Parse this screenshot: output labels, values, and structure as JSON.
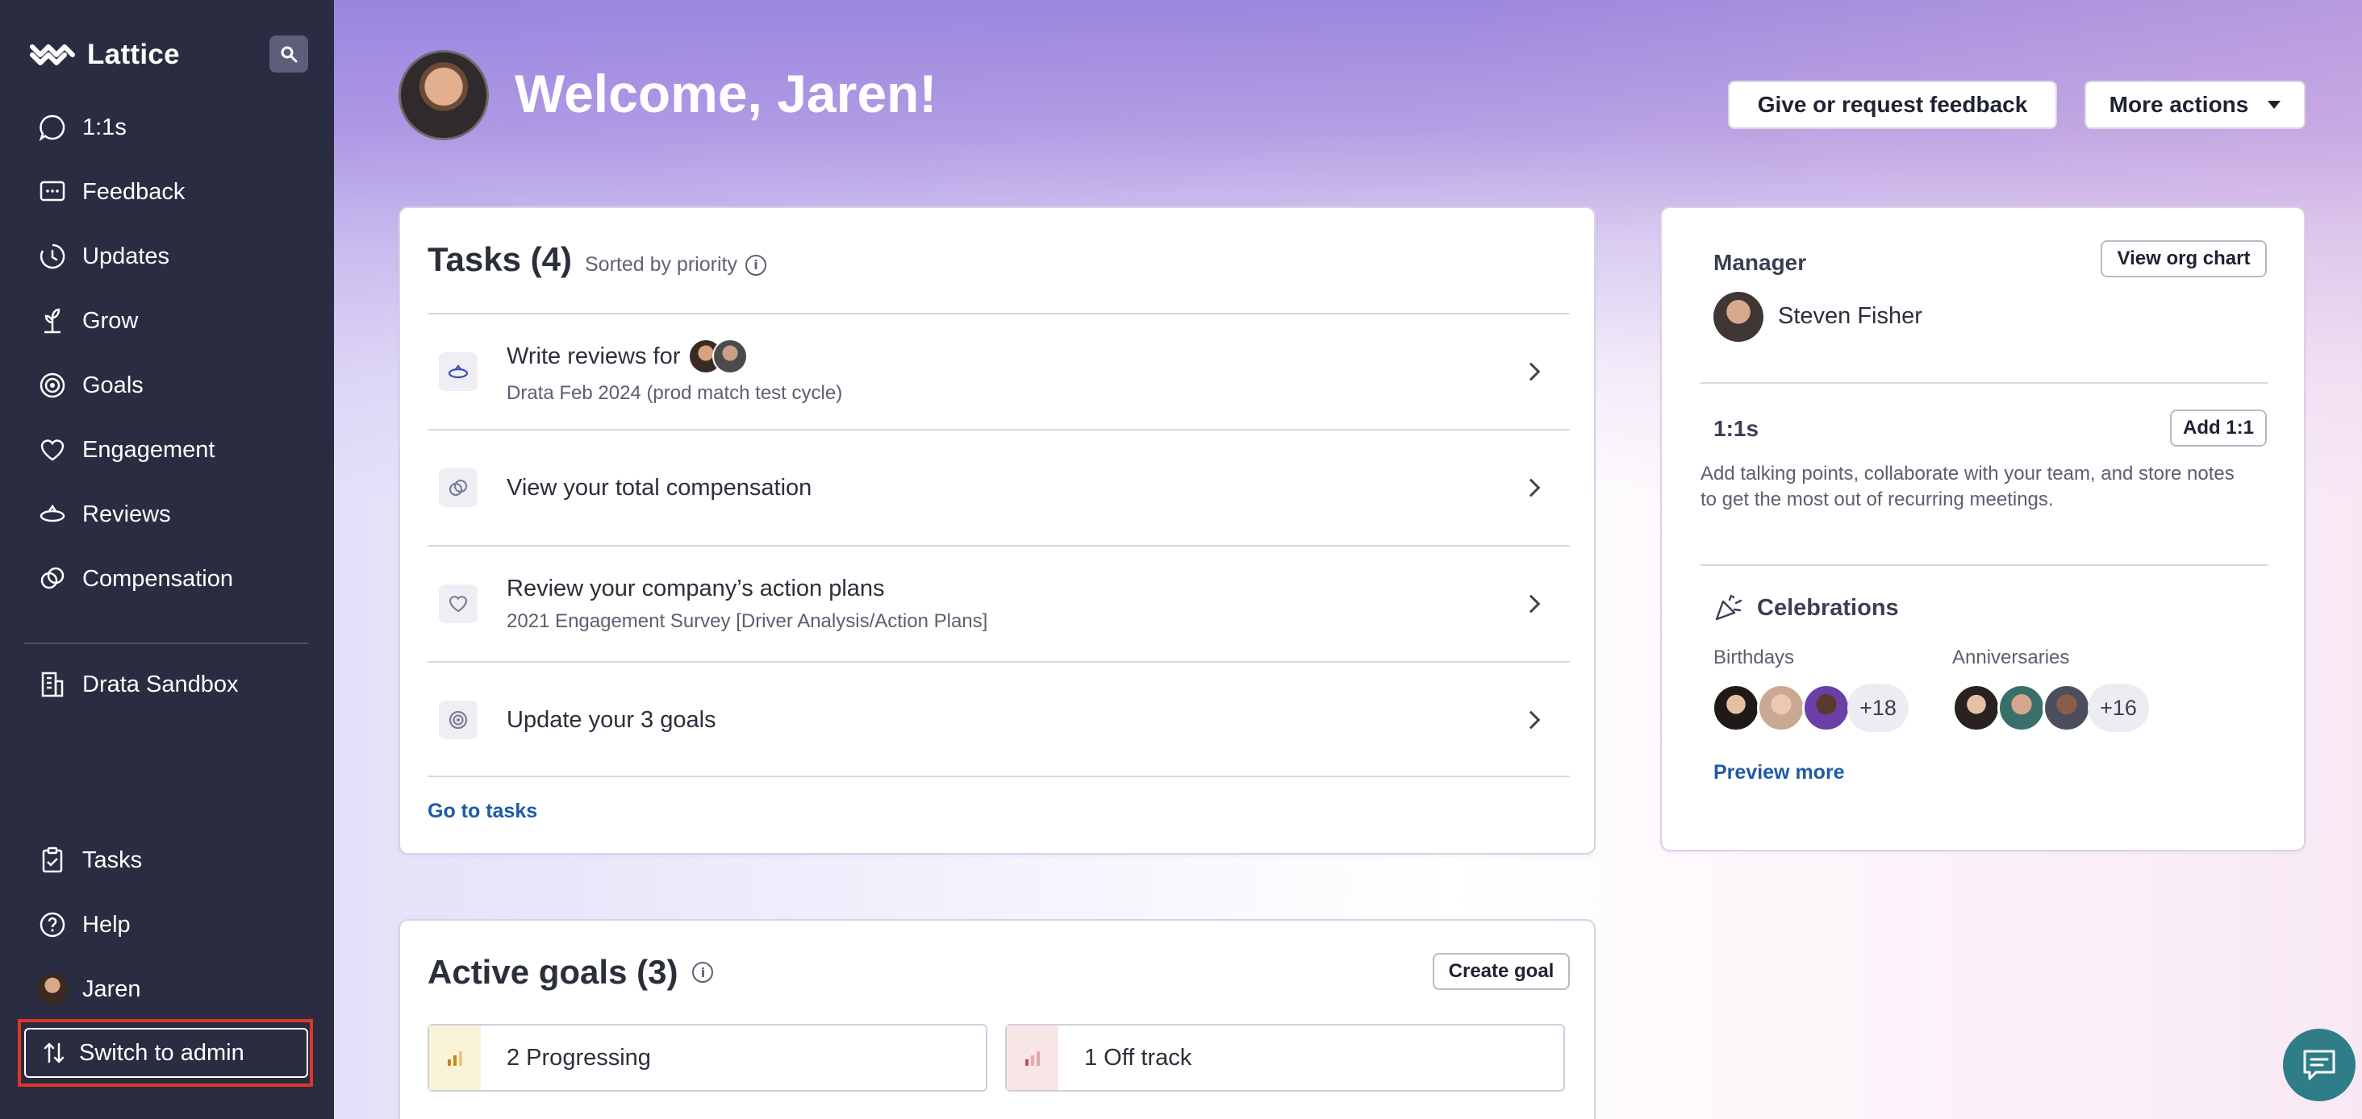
{
  "sidebar": {
    "brand": "Lattice",
    "items": [
      {
        "label": "1:1s",
        "icon": "chat-bubble-icon"
      },
      {
        "label": "Feedback",
        "icon": "feedback-icon"
      },
      {
        "label": "Updates",
        "icon": "updates-icon"
      },
      {
        "label": "Grow",
        "icon": "grow-icon"
      },
      {
        "label": "Goals",
        "icon": "target-icon"
      },
      {
        "label": "Engagement",
        "icon": "heart-icon"
      },
      {
        "label": "Reviews",
        "icon": "reviews-icon"
      },
      {
        "label": "Compensation",
        "icon": "compensation-icon"
      }
    ],
    "org": {
      "label": "Drata Sandbox",
      "icon": "building-icon"
    },
    "bottom": [
      {
        "label": "Tasks",
        "icon": "clipboard-icon"
      },
      {
        "label": "Help",
        "icon": "help-icon"
      },
      {
        "label": "Jaren",
        "icon": "avatar"
      }
    ],
    "switch_admin": "Switch to admin"
  },
  "header": {
    "welcome": "Welcome, Jaren!",
    "feedback_btn": "Give or request feedback",
    "more_btn": "More actions"
  },
  "tasks": {
    "title": "Tasks (4)",
    "sorted": "Sorted by priority",
    "rows": [
      {
        "title": "Write reviews for",
        "sub": "Drata Feb 2024 (prod match test cycle)"
      },
      {
        "title": "View your total compensation",
        "sub": ""
      },
      {
        "title": "Review your company’s action plans",
        "sub": "2021 Engagement Survey [Driver Analysis/Action Plans]"
      },
      {
        "title": "Update your 3 goals",
        "sub": ""
      }
    ],
    "go_link": "Go to tasks"
  },
  "side_card": {
    "manager_label": "Manager",
    "org_chart_btn": "View org chart",
    "manager_name": "Steven Fisher",
    "oneonone_label": "1:1s",
    "add_btn": "Add 1:1",
    "oneonone_desc": "Add talking points, collaborate with your team, and store notes to get the most out of recurring meetings.",
    "celebrations": "Celebrations",
    "birthdays": "Birthdays",
    "birthdays_more": "+18",
    "anniversaries": "Anniversaries",
    "anniversaries_more": "+16",
    "preview_more": "Preview more"
  },
  "goals": {
    "title": "Active goals (3)",
    "create_btn": "Create goal",
    "progressing": "2 Progressing",
    "off_track": "1 Off track"
  },
  "colors": {
    "sidebar_bg": "#2a2d41",
    "link_blue": "#1f5aa6",
    "highlight_red": "#e1352b",
    "chat_teal": "#2f7d88"
  }
}
